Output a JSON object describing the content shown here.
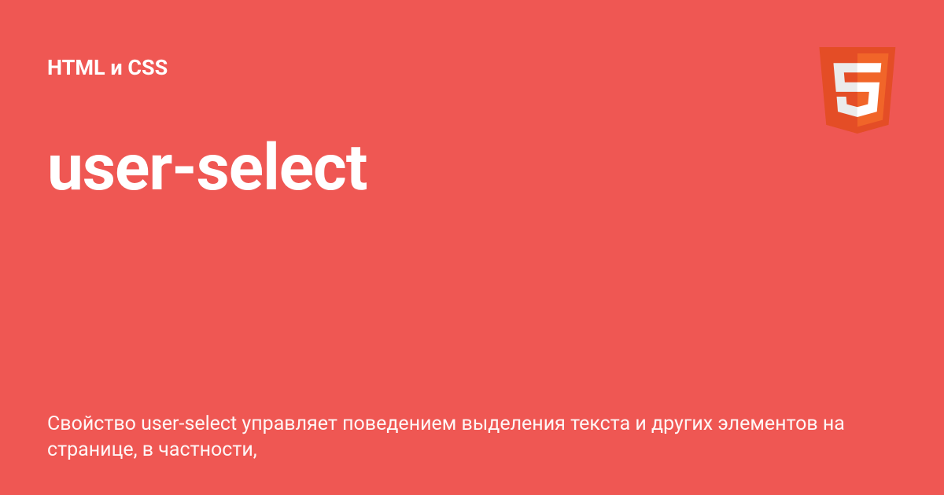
{
  "category": "HTML и CSS",
  "title": "user-select",
  "description": "Свойство user-select управляет поведением выделения текста и других элементов на странице, в частности,",
  "icon_name": "html5-logo-icon"
}
